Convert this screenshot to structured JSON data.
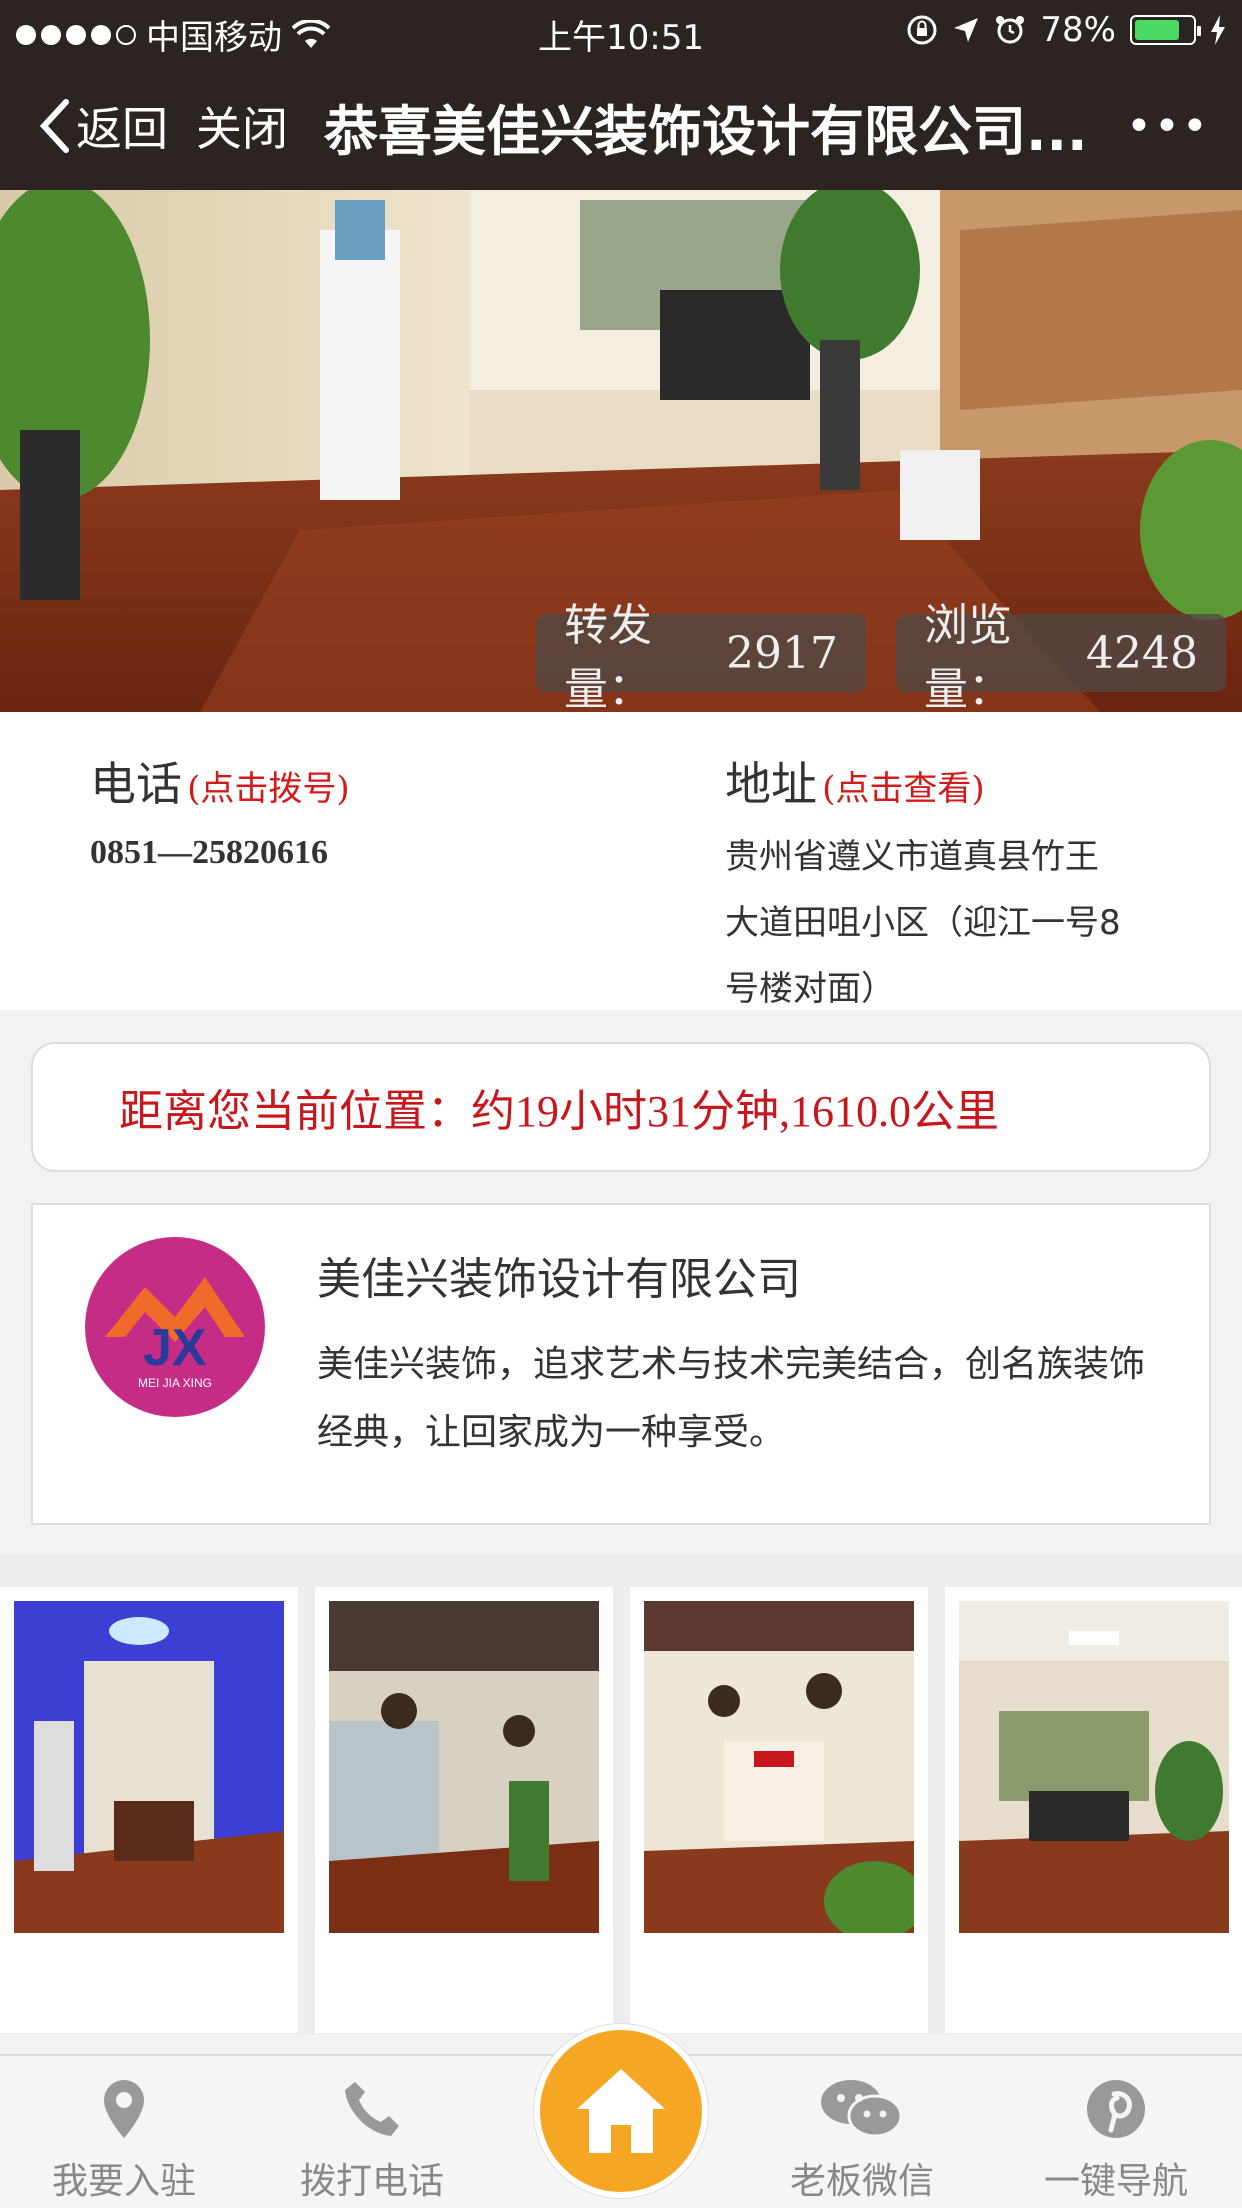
{
  "status_bar": {
    "carrier": "中国移动",
    "time": "上午10:51",
    "battery": "78%",
    "battery_level": 0.78
  },
  "nav": {
    "back_label": "返回",
    "close_label": "关闭",
    "title": "恭喜美佳兴装饰设计有限公司...",
    "more_label": "•••"
  },
  "banner": {
    "share_label": "转发量：",
    "share_count": "2917",
    "view_label": "浏览量：",
    "view_count": "4248"
  },
  "contact": {
    "phone_label": "电话",
    "phone_hint": "(点击拨号)",
    "phone_number": "0851—25820616",
    "address_label": "地址",
    "address_hint": "(点击查看)",
    "address_lines": [
      "贵州省遵义市道真县竹王",
      "大道田咀小区（迎江一号8",
      "号楼对面）"
    ]
  },
  "distance": {
    "text": "距离您当前位置：约19小时31分钟,1610.0公里"
  },
  "company": {
    "name": "美佳兴装饰设计有限公司",
    "description": "美佳兴装饰，追求艺术与技术完美结合，创名族装饰经典，让回家成为一种享受。",
    "logo_letters": "JX",
    "logo_text": "MEI JIA XING"
  },
  "gallery": {
    "photos": [
      "showroom-photo-1",
      "showroom-photo-2",
      "showroom-photo-3",
      "showroom-photo-4"
    ]
  },
  "tabbar": {
    "items": [
      {
        "label": "我要入驻",
        "icon": "location-pin-icon"
      },
      {
        "label": "拨打电话",
        "icon": "phone-icon"
      },
      {
        "label": "",
        "icon": "home-icon"
      },
      {
        "label": "老板微信",
        "icon": "wechat-icon"
      },
      {
        "label": "一键导航",
        "icon": "pinterest-icon"
      }
    ]
  },
  "colors": {
    "header_bg": "#2b2420",
    "accent_red": "#c8161d",
    "home_orange": "#f5a623",
    "logo_magenta": "#c52c86"
  }
}
